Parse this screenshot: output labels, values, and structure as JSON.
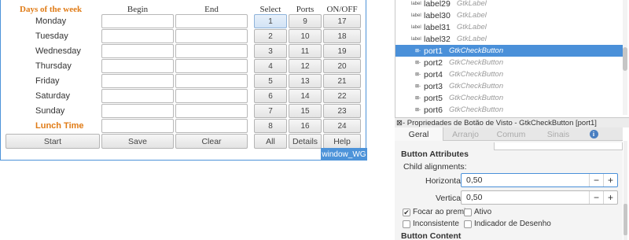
{
  "left_window": {
    "headers": {
      "days": "Days of the week",
      "begin": "Begin",
      "end": "End",
      "select": "Select",
      "ports": "Ports",
      "onoff": "ON/OFF"
    },
    "rows": [
      {
        "day": "Monday",
        "select": "1",
        "port": "9",
        "onoff": "17"
      },
      {
        "day": "Tuesday",
        "select": "2",
        "port": "10",
        "onoff": "18"
      },
      {
        "day": "Wednesday",
        "select": "3",
        "port": "11",
        "onoff": "19"
      },
      {
        "day": "Thursday",
        "select": "4",
        "port": "12",
        "onoff": "20"
      },
      {
        "day": "Friday",
        "select": "5",
        "port": "13",
        "onoff": "21"
      },
      {
        "day": "Saturday",
        "select": "6",
        "port": "14",
        "onoff": "22"
      },
      {
        "day": "Sunday",
        "select": "7",
        "port": "15",
        "onoff": "23"
      },
      {
        "day": "Lunch Time",
        "select": "8",
        "port": "16",
        "onoff": "24"
      }
    ],
    "buttons": {
      "start": "Start",
      "save": "Save",
      "clear": "Clear",
      "all": "All",
      "details": "Details",
      "help": "Help"
    },
    "window_name": "window_WG",
    "accent_color": "#4d93d9",
    "highlight_color": "#e07b16"
  },
  "tree": {
    "items": [
      {
        "icon": "label-icon",
        "marker": "label",
        "name": "label29",
        "type": "GtkLabel"
      },
      {
        "icon": "label-icon",
        "marker": "label",
        "name": "label30",
        "type": "GtkLabel"
      },
      {
        "icon": "label-icon",
        "marker": "label",
        "name": "label31",
        "type": "GtkLabel"
      },
      {
        "icon": "label-icon",
        "marker": "label",
        "name": "label32",
        "type": "GtkLabel"
      },
      {
        "icon": "check-icon",
        "marker": "⊠-",
        "name": "port1",
        "type": "GtkCheckButton",
        "selected": true
      },
      {
        "icon": "check-icon",
        "marker": "⊠-",
        "name": "port2",
        "type": "GtkCheckButton"
      },
      {
        "icon": "check-icon",
        "marker": "⊠-",
        "name": "port4",
        "type": "GtkCheckButton"
      },
      {
        "icon": "check-icon",
        "marker": "⊠-",
        "name": "port3",
        "type": "GtkCheckButton"
      },
      {
        "icon": "check-icon",
        "marker": "⊠-",
        "name": "port5",
        "type": "GtkCheckButton"
      },
      {
        "icon": "check-icon",
        "marker": "⊠-",
        "name": "port6",
        "type": "GtkCheckButton"
      }
    ],
    "selection_color": "#4a90d9"
  },
  "properties": {
    "title": "⊠- Propriedades de Botão de Visto - GtkCheckButton [port1]",
    "tabs": [
      "Geral",
      "Arranjo",
      "Comum",
      "Sinais"
    ],
    "info_tab_glyph": "i",
    "button_attributes": "Button Attributes",
    "child_alignments": "Child alignments:",
    "horizontal_label": "Horizontal:",
    "horizontal_value": "0,50",
    "vertical_label": "Vertical:",
    "vertical_value": "0,50",
    "spin_minus": "−",
    "spin_plus": "+",
    "focus_on_press": "Focar ao premir",
    "focus_on_press_checked": true,
    "active": "Ativo",
    "inconsistent": "Inconsistente",
    "draw_indicator": "Indicador de Desenho",
    "button_content": "Button Content",
    "check_mark": "✔"
  }
}
